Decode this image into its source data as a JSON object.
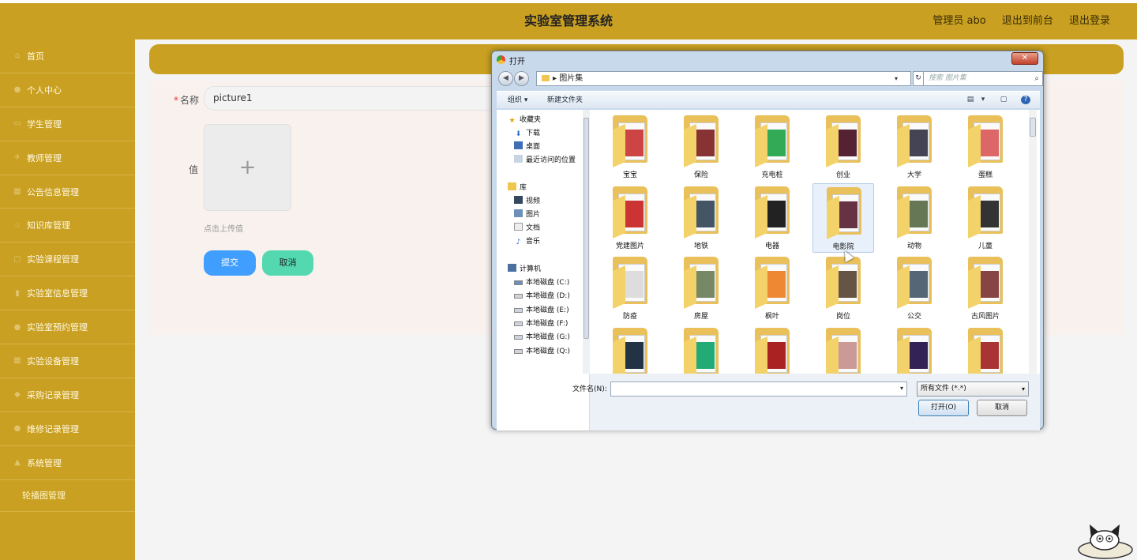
{
  "header": {
    "title": "实验室管理系统",
    "user": "管理员 abo",
    "to_front": "退出到前台",
    "logout": "退出登录"
  },
  "sidebar": {
    "items": [
      {
        "label": "首页",
        "icon": "home-icon"
      },
      {
        "label": "个人中心",
        "icon": "user-icon"
      },
      {
        "label": "学生管理",
        "icon": "students-icon"
      },
      {
        "label": "教师管理",
        "icon": "teacher-icon"
      },
      {
        "label": "公告信息管理",
        "icon": "notice-icon"
      },
      {
        "label": "知识库管理",
        "icon": "knowledge-icon"
      },
      {
        "label": "实验课程管理",
        "icon": "course-icon"
      },
      {
        "label": "实验室信息管理",
        "icon": "chart-icon"
      },
      {
        "label": "实验室预约管理",
        "icon": "reservation-icon"
      },
      {
        "label": "实验设备管理",
        "icon": "device-icon"
      },
      {
        "label": "采购记录管理",
        "icon": "purchase-icon"
      },
      {
        "label": "维修记录管理",
        "icon": "repair-icon"
      },
      {
        "label": "系统管理",
        "icon": "system-icon"
      }
    ],
    "sub_item": "轮播图管理"
  },
  "form": {
    "name_label": "名称",
    "name_value": "picture1",
    "value_label": "值",
    "upload_plus": "+",
    "upload_hint": "点击上传值",
    "submit": "提交",
    "cancel": "取消"
  },
  "dialog": {
    "title": "打开",
    "close": "✕",
    "path": "图片集",
    "search_placeholder": "搜索 图片集",
    "organize": "组织 ▾",
    "new_folder": "新建文件夹",
    "tree": {
      "favorites": "收藏夹",
      "downloads": "下载",
      "desktop": "桌面",
      "recent": "最近访问的位置",
      "library": "库",
      "videos": "视频",
      "pictures": "图片",
      "documents": "文档",
      "music": "音乐",
      "computer": "计算机",
      "drives": [
        "本地磁盘 (C:)",
        "本地磁盘 (D:)",
        "本地磁盘 (E:)",
        "本地磁盘 (F:)",
        "本地磁盘 (G:)",
        "本地磁盘 (Q:)"
      ]
    },
    "folders": [
      "宝宝",
      "保险",
      "充电桩",
      "创业",
      "大学",
      "蛋糕",
      "党建图片",
      "地铁",
      "电器",
      "电影院",
      "动物",
      "儿童",
      "防疫",
      "房屋",
      "枫叶",
      "岗位",
      "公交",
      "古风图片",
      "",
      "",
      "",
      "",
      "",
      ""
    ],
    "selected_folder": "电影院",
    "filename_label": "文件名(N):",
    "filetype": "所有文件 (*.*)",
    "open_button": "打开(O)",
    "cancel_button": "取消"
  },
  "colors": {
    "brand": "#c9a022",
    "submit": "#409eff",
    "cancel": "#54d8b0"
  }
}
